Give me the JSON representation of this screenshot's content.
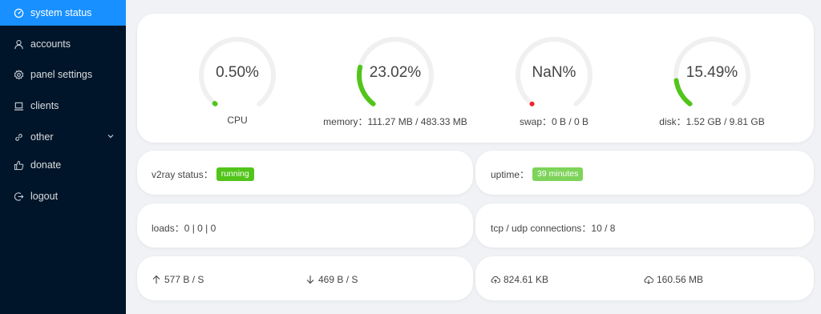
{
  "sidebar": {
    "items": [
      {
        "label": "system status",
        "icon": "dashboard-icon",
        "active": true
      },
      {
        "label": "accounts",
        "icon": "user-icon"
      },
      {
        "label": "panel settings",
        "icon": "gear-icon"
      },
      {
        "label": "clients",
        "icon": "laptop-icon"
      },
      {
        "label": "other",
        "icon": "link-icon"
      },
      {
        "label": "donate",
        "icon": "like-icon"
      },
      {
        "label": "logout",
        "icon": "logout-icon"
      }
    ]
  },
  "gauges": [
    {
      "value": "0.50%",
      "caption": "CPU",
      "percent": 0.5,
      "color": "#52c41a"
    },
    {
      "value": "23.02%",
      "caption": "memory：111.27 MB / 483.33 MB",
      "percent": 23.02,
      "color": "#52c41a"
    },
    {
      "value": "NaN%",
      "caption": "swap：0 B / 0 B",
      "percent": 0,
      "color": "#f5222d"
    },
    {
      "value": "15.49%",
      "caption": "disk：1.52 GB / 9.81 GB",
      "percent": 15.49,
      "color": "#52c41a"
    }
  ],
  "status": {
    "v2ray_label": "v2ray status：",
    "v2ray_state": "running",
    "uptime_label": "uptime：",
    "uptime_value": "39 minutes",
    "loads": "loads：0 | 0 | 0",
    "connections": "tcp / udp connections：10 / 8",
    "upload_speed": "577 B / S",
    "download_speed": "469 B / S",
    "total_upload": "824.61 KB",
    "total_download": "160.56 MB"
  },
  "colors": {
    "sidebar_bg": "#001529",
    "active_bg": "#1890ff",
    "running_tag": "#52c41a",
    "uptime_tag": "#7ed35a",
    "page_bg": "#f0f2f5"
  }
}
